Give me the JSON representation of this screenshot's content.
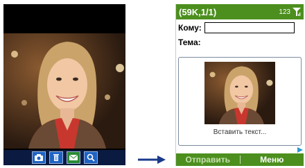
{
  "camera_screen": {
    "photo": "portrait-photo",
    "toolbar": [
      {
        "icon": "camera-icon",
        "color": "#1e62c4"
      },
      {
        "icon": "trash-icon",
        "color": "#1e62c4"
      },
      {
        "icon": "envelope-icon",
        "color": "#2a8a35"
      },
      {
        "icon": "magnifier-icon",
        "color": "#1e62c4"
      }
    ]
  },
  "composer": {
    "status": {
      "title": "(59K,1/1)",
      "input_mode": "123",
      "signal": "signal-icon"
    },
    "to_label": "Кому:",
    "to_value": "",
    "subject_label": "Тема:",
    "insert_text": "Вставить текст...",
    "softkeys": {
      "left": "Отправить",
      "right": "Меню"
    },
    "accent_color": "#4c8f1e"
  }
}
